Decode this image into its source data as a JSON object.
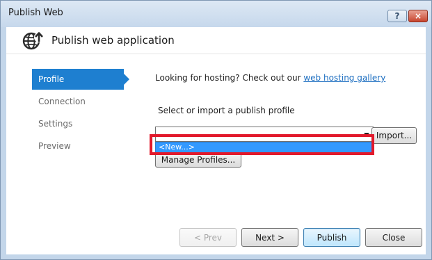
{
  "window": {
    "title": "Publish Web",
    "help_label": "?",
    "close_label": "×"
  },
  "header": {
    "title": "Publish web application",
    "icon": "globe-publish-icon"
  },
  "nav": {
    "items": [
      {
        "label": "Profile",
        "active": true
      },
      {
        "label": "Connection",
        "active": false
      },
      {
        "label": "Settings",
        "active": false
      },
      {
        "label": "Preview",
        "active": false
      }
    ]
  },
  "profile": {
    "hosting_prefix": "Looking for hosting? Check out our ",
    "hosting_link": "web hosting gallery",
    "select_label": "Select or import a publish profile",
    "combo_value": "",
    "dropdown_option": "<New...>",
    "import_label": "Import...",
    "manage_label": "Manage Profiles..."
  },
  "footer": {
    "prev_label": "< Prev",
    "next_label": "Next >",
    "publish_label": "Publish",
    "close_label": "Close"
  },
  "colors": {
    "accent": "#1e7fd0",
    "selection": "#3399ff",
    "callout": "#e2192b",
    "link": "#1e6fc1"
  }
}
